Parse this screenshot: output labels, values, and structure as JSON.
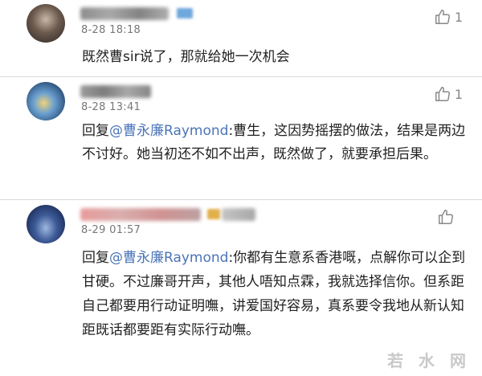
{
  "comments": [
    {
      "time": "8-28 18:18",
      "segments": [
        {
          "text": "既然曹sir说了，那就给她一次机会"
        }
      ],
      "like_count": "1"
    },
    {
      "time": "8-28 13:41",
      "segments": [
        {
          "text": "回复"
        },
        {
          "text": "@曹永廉Raymond"
        },
        {
          "text": ":曹生，这因势摇摆的做法，结果是两边不讨好。她当初还不如不出声，既然做了，就要承担后果。"
        }
      ],
      "like_count": "1"
    },
    {
      "time": "8-29 01:57",
      "segments": [
        {
          "text": "回复"
        },
        {
          "text": "@曹永廉Raymond"
        },
        {
          "text": ":你都有生意系香港嘅，点解你可以企到甘硬。不过廉哥开声，其他人唔知点霖，我就选择信你。但系距自己都要用行动证明嘸，讲爱国好容易，真系要令我地从新认知距既话都要距有实际行动嘸。"
        }
      ],
      "like_count": ""
    }
  ],
  "watermark": "若 水 网",
  "colors": {
    "mention": "#4a74b8",
    "like_icon": "#888888",
    "background": "#f4f4f4"
  },
  "icons": [
    "thumbs-up-icon",
    "vip-badge-icon"
  ]
}
